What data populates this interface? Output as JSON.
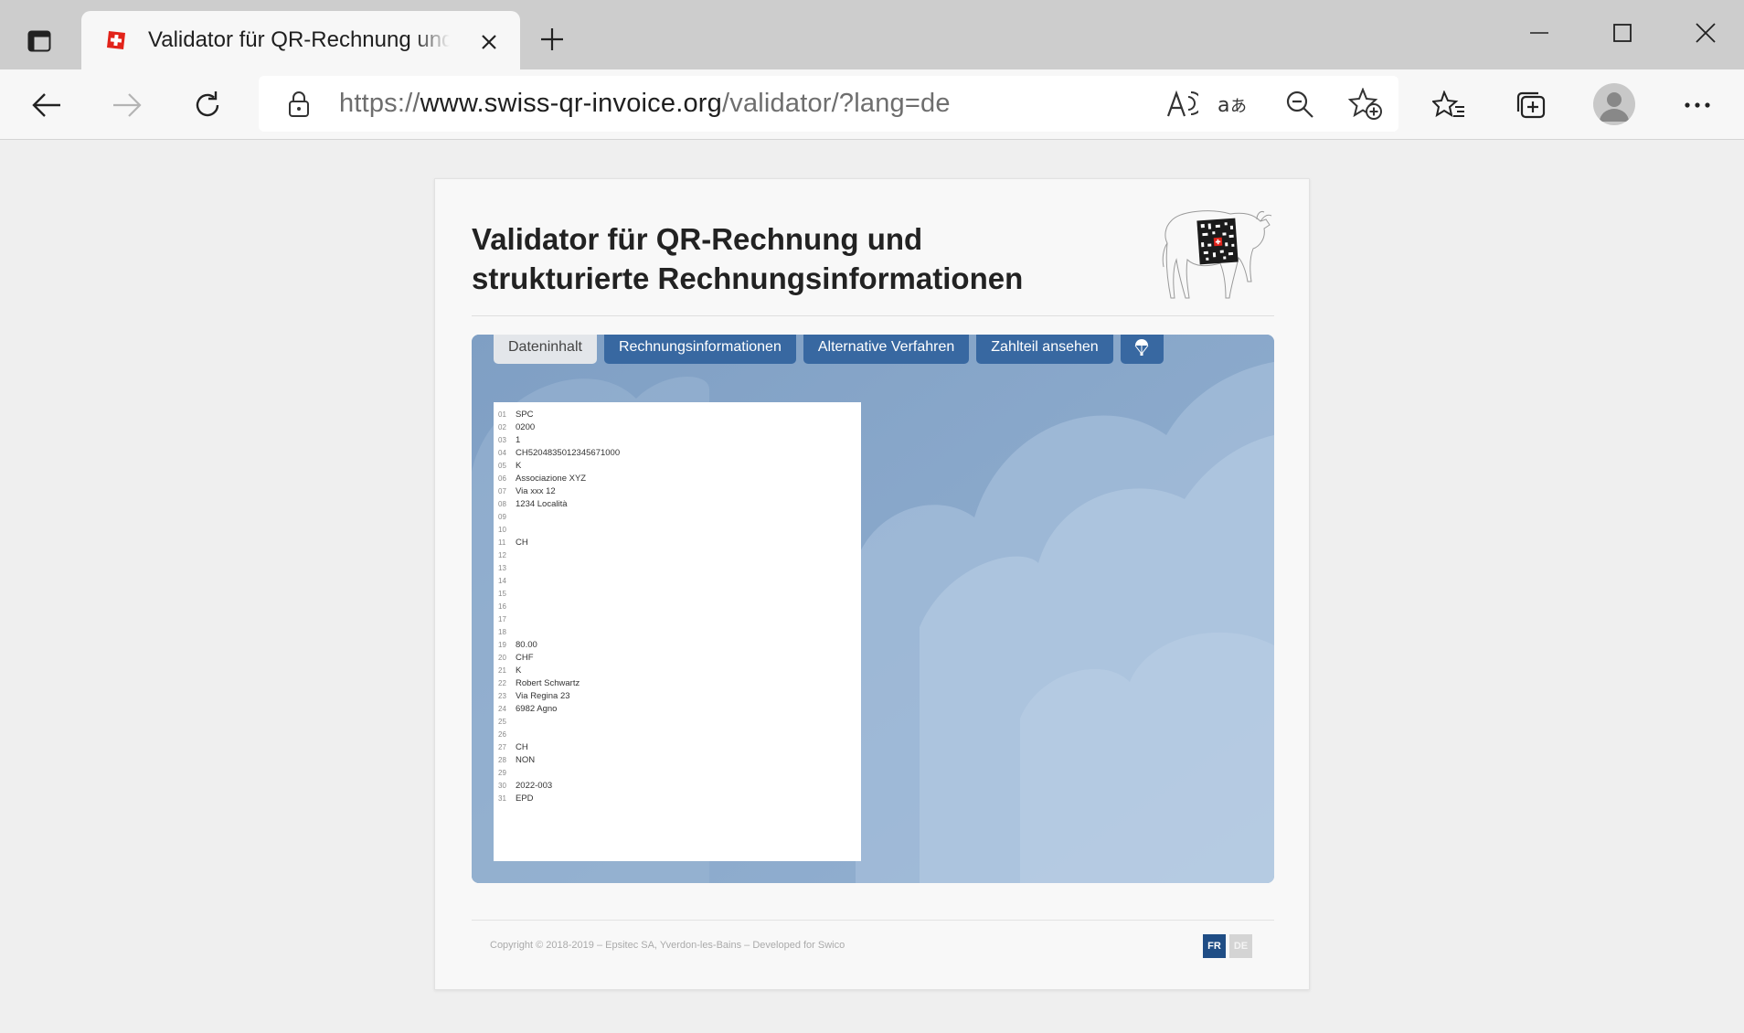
{
  "browser": {
    "tab_title": "Validator für QR-Rechnung und strukturierte Rechnungsinformationen",
    "url_scheme": "https://",
    "url_host": "www.swiss-qr-invoice.org",
    "url_path": "/validator/?lang=de",
    "icons": [
      "tab-actions-icon",
      "swiss-favicon",
      "close-icon",
      "plus-icon",
      "minimize-icon",
      "maximize-icon",
      "window-close-icon",
      "back-icon",
      "forward-icon",
      "refresh-icon",
      "lock-icon",
      "read-aloud-icon",
      "translate-icon",
      "zoom-out-icon",
      "add-favorite-icon",
      "favorites-icon",
      "collections-icon",
      "profile-icon",
      "more-icon"
    ]
  },
  "page": {
    "title_line1": "Validator für QR-Rechnung und",
    "title_line2": "strukturierte Rechnungsinformationen",
    "tabs": [
      {
        "label": "Dateninhalt",
        "active": true
      },
      {
        "label": "Rechnungsinformationen",
        "active": false
      },
      {
        "label": "Alternative Verfahren",
        "active": false
      },
      {
        "label": "Zahlteil ansehen",
        "active": false
      }
    ],
    "help_icon": "parachute-icon",
    "data_lines": [
      {
        "n": "01",
        "v": "SPC"
      },
      {
        "n": "02",
        "v": "0200"
      },
      {
        "n": "03",
        "v": "1"
      },
      {
        "n": "04",
        "v": "CH5204835012345671000"
      },
      {
        "n": "05",
        "v": "K"
      },
      {
        "n": "06",
        "v": "Associazione XYZ"
      },
      {
        "n": "07",
        "v": "Via xxx 12"
      },
      {
        "n": "08",
        "v": "1234 Località"
      },
      {
        "n": "09",
        "v": ""
      },
      {
        "n": "10",
        "v": ""
      },
      {
        "n": "11",
        "v": "CH"
      },
      {
        "n": "12",
        "v": ""
      },
      {
        "n": "13",
        "v": ""
      },
      {
        "n": "14",
        "v": ""
      },
      {
        "n": "15",
        "v": ""
      },
      {
        "n": "16",
        "v": ""
      },
      {
        "n": "17",
        "v": ""
      },
      {
        "n": "18",
        "v": ""
      },
      {
        "n": "19",
        "v": "80.00"
      },
      {
        "n": "20",
        "v": "CHF"
      },
      {
        "n": "21",
        "v": "K"
      },
      {
        "n": "22",
        "v": "Robert Schwartz"
      },
      {
        "n": "23",
        "v": "Via Regina 23"
      },
      {
        "n": "24",
        "v": "6982 Agno"
      },
      {
        "n": "25",
        "v": ""
      },
      {
        "n": "26",
        "v": ""
      },
      {
        "n": "27",
        "v": "CH"
      },
      {
        "n": "28",
        "v": "NON"
      },
      {
        "n": "29",
        "v": ""
      },
      {
        "n": "30",
        "v": "2022-003"
      },
      {
        "n": "31",
        "v": "EPD"
      }
    ],
    "copyright": "Copyright © 2018-2019 – Epsitec SA, Yverdon-les-Bains – Developed for Swico",
    "lang_fr": "FR",
    "lang_de": "DE"
  },
  "colors": {
    "tab_blue": "#3868a1",
    "lang_active": "#1f4d85",
    "panel_bg": "#89a9cb"
  }
}
